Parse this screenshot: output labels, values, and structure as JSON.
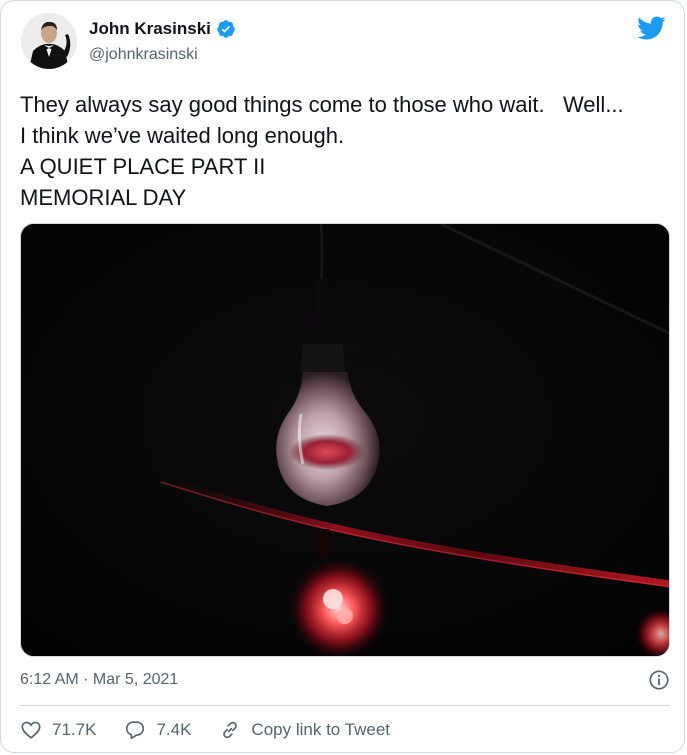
{
  "author": {
    "name": "John Krasinski",
    "handle": "@johnkrasinski",
    "verified": true
  },
  "tweet": {
    "lines": [
      "They always say good things come to those who wait.   Well...",
      "I think we’ve waited long enough.",
      "A QUIET PLACE PART II",
      "MEMORIAL DAY"
    ],
    "timestamp": "6:12 AM · Mar 5, 2021"
  },
  "actions": {
    "likes": "71.7K",
    "replies": "7.4K",
    "copy_link": "Copy link to Tweet"
  },
  "icons": {
    "brand": "twitter-bird-icon",
    "verified": "verified-badge-icon",
    "info": "info-icon",
    "like": "heart-icon",
    "reply": "reply-bubble-icon",
    "link": "link-icon"
  },
  "colors": {
    "brand": "#1d9bf0",
    "text": "#0f1419",
    "muted": "#536471",
    "border": "#cfd9de"
  }
}
